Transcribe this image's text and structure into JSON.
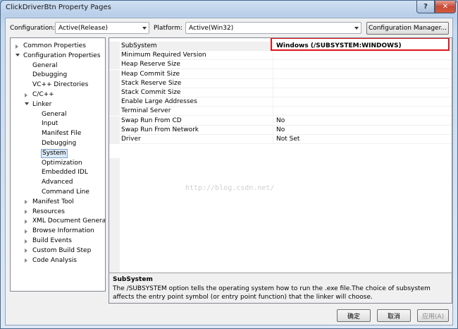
{
  "window": {
    "title": "ClickDriverBtn Property Pages",
    "help": "?",
    "close": "✕"
  },
  "toolbar": {
    "configuration_label": "Configuration:",
    "configuration_value": "Active(Release)",
    "platform_label": "Platform:",
    "platform_value": "Active(Win32)",
    "config_manager_label": "Configuration Manager..."
  },
  "tree": {
    "items": [
      {
        "label": "Common Properties",
        "expander": "collapsed",
        "selected": false
      },
      {
        "label": "Configuration Properties",
        "expander": "expanded",
        "selected": false
      },
      {
        "label": "General",
        "expander": "none",
        "selected": false
      },
      {
        "label": "Debugging",
        "expander": "none",
        "selected": false
      },
      {
        "label": "VC++ Directories",
        "expander": "none",
        "selected": false
      },
      {
        "label": "C/C++",
        "expander": "collapsed",
        "selected": false
      },
      {
        "label": "Linker",
        "expander": "expanded",
        "selected": false
      },
      {
        "label": "General",
        "expander": "none",
        "selected": false
      },
      {
        "label": "Input",
        "expander": "none",
        "selected": false
      },
      {
        "label": "Manifest File",
        "expander": "none",
        "selected": false
      },
      {
        "label": "Debugging",
        "expander": "none",
        "selected": false
      },
      {
        "label": "System",
        "expander": "none",
        "selected": true
      },
      {
        "label": "Optimization",
        "expander": "none",
        "selected": false
      },
      {
        "label": "Embedded IDL",
        "expander": "none",
        "selected": false
      },
      {
        "label": "Advanced",
        "expander": "none",
        "selected": false
      },
      {
        "label": "Command Line",
        "expander": "none",
        "selected": false
      },
      {
        "label": "Manifest Tool",
        "expander": "collapsed",
        "selected": false
      },
      {
        "label": "Resources",
        "expander": "collapsed",
        "selected": false
      },
      {
        "label": "XML Document Generat",
        "expander": "collapsed",
        "selected": false
      },
      {
        "label": "Browse Information",
        "expander": "collapsed",
        "selected": false
      },
      {
        "label": "Build Events",
        "expander": "collapsed",
        "selected": false
      },
      {
        "label": "Custom Build Step",
        "expander": "collapsed",
        "selected": false
      },
      {
        "label": "Code Analysis",
        "expander": "collapsed",
        "selected": false
      }
    ]
  },
  "grid": {
    "rows": [
      {
        "name": "SubSystem",
        "value": "Windows (/SUBSYSTEM:WINDOWS)"
      },
      {
        "name": "Minimum Required Version",
        "value": ""
      },
      {
        "name": "Heap Reserve Size",
        "value": ""
      },
      {
        "name": "Heap Commit Size",
        "value": ""
      },
      {
        "name": "Stack Reserve Size",
        "value": ""
      },
      {
        "name": "Stack Commit Size",
        "value": ""
      },
      {
        "name": "Enable Large Addresses",
        "value": ""
      },
      {
        "name": "Terminal Server",
        "value": ""
      },
      {
        "name": "Swap Run From CD",
        "value": "No"
      },
      {
        "name": "Swap Run From Network",
        "value": "No"
      },
      {
        "name": "Driver",
        "value": "Not Set"
      }
    ],
    "watermark": "http://blog.csdn.net/"
  },
  "description": {
    "title": "SubSystem",
    "body": "The /SUBSYSTEM option tells the operating system how to run the .exe file.The choice of subsystem affects the entry point symbol (or entry point function) that the linker will choose."
  },
  "buttons": {
    "ok": "确定",
    "cancel": "取消",
    "apply": "应用(A)"
  },
  "colors": {
    "highlight_border": "#e0141b",
    "selection": "#dceaf7"
  }
}
